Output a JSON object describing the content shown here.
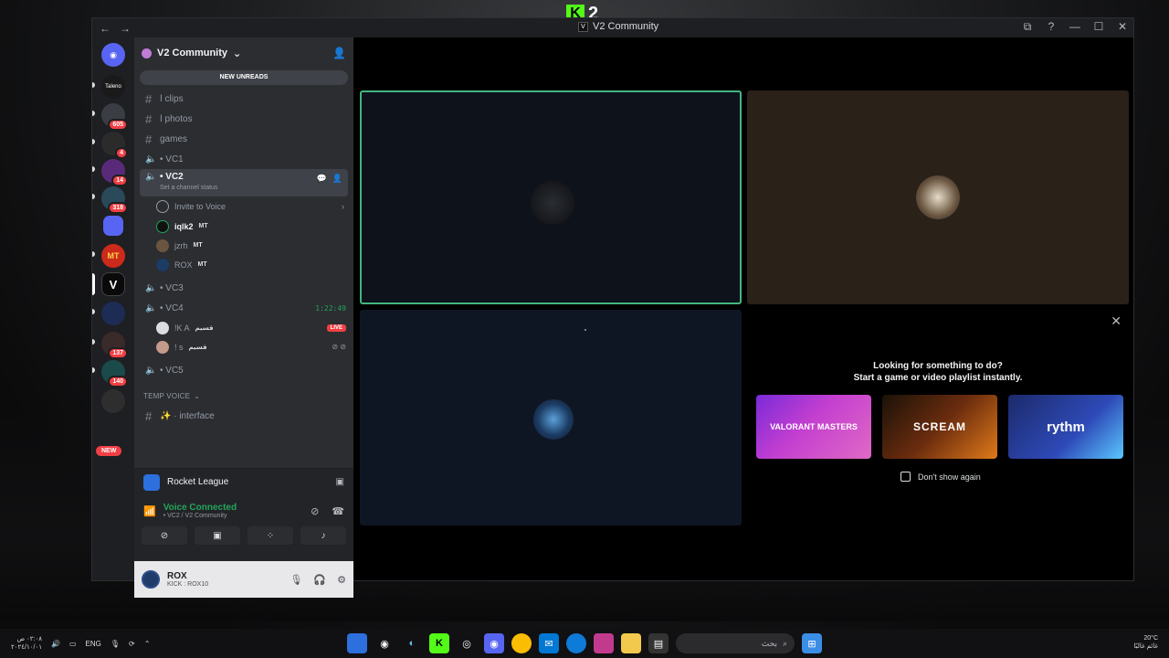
{
  "overlay": {
    "logo_letter": "K",
    "logo_number": "2"
  },
  "window": {
    "title": "V2 Community",
    "badge": "V",
    "controls": [
      "⧉",
      "?",
      "—",
      "☐",
      "✕"
    ]
  },
  "rail": {
    "servers": [
      {
        "label": "Taleno",
        "badge": ""
      },
      {
        "label": "",
        "badge": "605"
      },
      {
        "label": "",
        "badge": "4"
      },
      {
        "label": "",
        "badge": "14"
      },
      {
        "label": "",
        "badge": "318"
      },
      {
        "label": "",
        "badge": ""
      },
      {
        "label": "MT",
        "badge": ""
      },
      {
        "label": "V",
        "badge": ""
      },
      {
        "label": "",
        "badge": ""
      },
      {
        "label": "",
        "badge": "137"
      },
      {
        "label": "",
        "badge": "140"
      },
      {
        "label": "",
        "badge": ""
      }
    ],
    "new_badge": "NEW"
  },
  "guild": {
    "name": "V2 Community",
    "new_unreads": "NEW UNREADS",
    "text_channels": [
      {
        "name": "ا clips"
      },
      {
        "name": "ا photos"
      },
      {
        "name": "games"
      }
    ],
    "vc1": "• VC1",
    "vc2": {
      "name": "• VC2",
      "status_placeholder": "Set a channel status",
      "invite": "Invite to Voice",
      "members": [
        {
          "name": "iqlk2",
          "role": "MT"
        },
        {
          "name": "jzrh",
          "role": "MT"
        },
        {
          "name": "ROX",
          "role": "MT"
        }
      ]
    },
    "vc3": "• VC3",
    "vc4": {
      "name": "• VC4",
      "timer": "1:22:49",
      "members": [
        {
          "name": "!K A",
          "role": "قسيم",
          "extra": "LIVE"
        },
        {
          "name": "! s",
          "role": "قسيم",
          "extra": ""
        }
      ]
    },
    "vc5": "• VC5",
    "temp_voice": "TEMP VOICE",
    "interface": "✨ · interface"
  },
  "activity": {
    "name": "Rocket League"
  },
  "voice": {
    "status": "Voice Connected",
    "location": "• VC2 / V2 Community"
  },
  "user": {
    "name": "ROX",
    "status": "KICK : ROX10"
  },
  "activity_card": {
    "line1": "Looking for something to do?",
    "line2": "Start a game or video playlist instantly.",
    "games": [
      {
        "label": "VALORANT MASTERS"
      },
      {
        "label": "SCREAM"
      },
      {
        "label": "rythm"
      }
    ],
    "dont_show": "Don't show again"
  },
  "taskbar": {
    "lang": "ENG",
    "time_line1": "٠٢:٠٨ ص",
    "time_line2": "٢٠٢٤/١٠/٠١",
    "search_placeholder": "بحث",
    "weather_line1": "20°C",
    "weather_line2": "غائم غالبًا"
  }
}
